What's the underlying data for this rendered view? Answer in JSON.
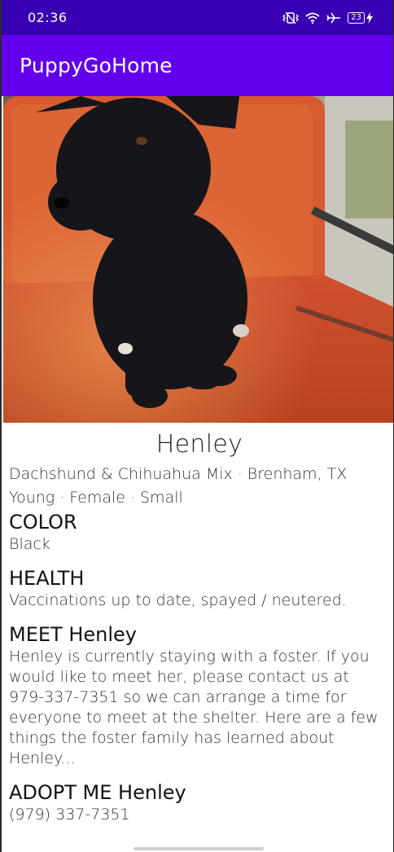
{
  "status_bar": {
    "time": "02:36",
    "battery_level": "23",
    "icons": [
      "vibrate-icon",
      "wifi-icon",
      "airplane-icon",
      "battery-icon",
      "charging-icon"
    ]
  },
  "app_bar": {
    "title": "PuppyGoHome"
  },
  "pet": {
    "name": "Henley",
    "breed": "Dachshund & Chihuahua Mix",
    "location": "Brenham, TX",
    "age": "Young",
    "gender": "Female",
    "size": "Small"
  },
  "sections": {
    "color": {
      "title": "COLOR",
      "text": "Black"
    },
    "health": {
      "title": "HEALTH",
      "text": "Vaccinations up to date, spayed / neutered."
    },
    "meet": {
      "title": "MEET Henley",
      "lines": [
        "Henley is currently staying with a foster. If you",
        "would like to meet her, please contact us at",
        "979-337-7351 so we can arrange a time for",
        "everyone to meet at the shelter. Here are a few",
        "things the foster family has learned about Henley..."
      ]
    },
    "adopt": {
      "title": "ADOPT ME Henley",
      "phone": "(979) 337-7351"
    }
  },
  "colors": {
    "status_bar": "#3700b3",
    "app_bar": "#6200ee",
    "chair": "#d8552c",
    "dog": "#15151a"
  }
}
